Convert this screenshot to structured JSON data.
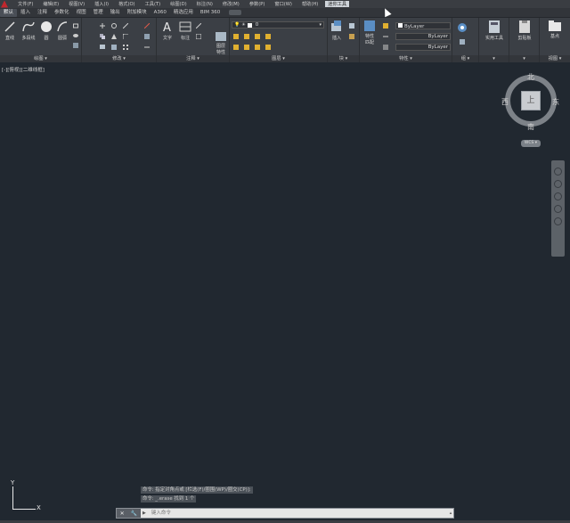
{
  "menubar": {
    "items": [
      "文件(F)",
      "编辑(E)",
      "视图(V)",
      "插入(I)",
      "格式(O)",
      "工具(T)",
      "绘图(D)",
      "标注(N)",
      "修改(M)",
      "参数(P)",
      "窗口(W)",
      "帮助(H)",
      "迷你工具"
    ],
    "active_index": 12
  },
  "ribbon": {
    "tabs": [
      "默认",
      "插入",
      "注释",
      "参数化",
      "视图",
      "管理",
      "输出",
      "附加模块",
      "A360",
      "精选应用",
      "BIM 360"
    ],
    "active_tab_index": 0,
    "panels": {
      "draw": {
        "title": "绘图 ▾",
        "line": "直线",
        "polyline": "多段线",
        "circle": "圆",
        "arc": "圆弧"
      },
      "modify": {
        "title": "修改 ▾"
      },
      "annotation": {
        "title": "注释 ▾",
        "text": "文字",
        "dimension": "标注"
      },
      "layers": {
        "title": "图层 ▾",
        "layer_props_line1": "图层",
        "layer_props_line2": "特性",
        "current_layer": "0"
      },
      "block": {
        "title": "块 ▾",
        "insert": "插入"
      },
      "properties": {
        "title": "特性 ▾",
        "match_line1": "特性",
        "match_line2": "匹配",
        "color": "ByLayer",
        "linetype": "ByLayer",
        "lineweight": "ByLayer"
      },
      "groups": {
        "title": "组 ▾"
      },
      "utilities": {
        "title": "▾",
        "label": "实用工具"
      },
      "clipboard": {
        "title": "▾",
        "label": "剪贴板"
      },
      "view": {
        "title": "视图 ▾",
        "label": "基点"
      }
    }
  },
  "viewport": {
    "label": "[-][俯视][二维线框]",
    "viewcube": {
      "north": "北",
      "south": "南",
      "east": "东",
      "west": "西",
      "face": "上"
    },
    "wcs": "WCS ▾",
    "ucs_x": "X",
    "ucs_y": "Y"
  },
  "command": {
    "history": [
      "命令: 指定对角点或 [栏选(F)/圈围(WP)/圈交(CP)]:",
      "命令: _.erase 找到 1 个"
    ],
    "input_placeholder": "键入命令",
    "prompt_icon": "▶"
  },
  "colors": {
    "canvas": "#212830",
    "ribbon": "#3b3f45",
    "menubar": "#3a3d42"
  }
}
